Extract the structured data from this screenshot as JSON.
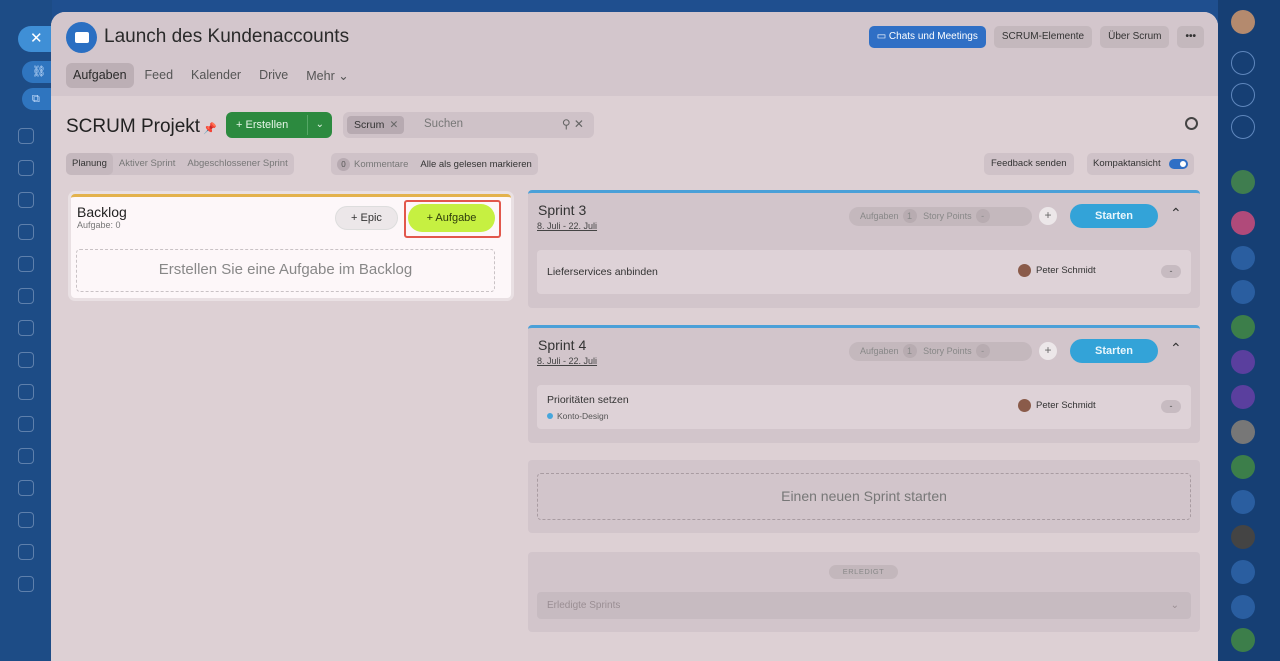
{
  "window": {
    "title": "Launch des Kundenaccounts",
    "tabs": [
      "Aufgaben",
      "Feed",
      "Kalender",
      "Drive",
      "Mehr"
    ],
    "header_buttons": {
      "chats": "Chats und Meetings",
      "scrum_elements": "SCRUM-Elemente",
      "about_scrum": "Über Scrum",
      "more": "•••"
    }
  },
  "toolbar": {
    "section_title": "SCRUM Projekt",
    "create_label": "+ Erstellen",
    "search_chip": "Scrum",
    "search_placeholder": "Suchen"
  },
  "subtabs": [
    "Planung",
    "Aktiver Sprint",
    "Abgeschlossener Sprint"
  ],
  "comments": {
    "count": "0",
    "label": "Kommentare",
    "mark_read": "Alle als gelesen markieren"
  },
  "feedback_label": "Feedback senden",
  "compact_label": "Kompaktansicht",
  "backlog": {
    "title": "Backlog",
    "count": "Aufgabe: 0",
    "epic_label": "+  Epic",
    "task_label": "+  Aufgabe",
    "empty_text": "Erstellen Sie eine Aufgabe im Backlog"
  },
  "sprints": [
    {
      "name": "Sprint 3",
      "dates": "8. Juli - 22. Juli",
      "tasks_label": "Aufgaben",
      "tasks_count": "1",
      "points_label": "Story Points",
      "points_value": "-",
      "add": "+",
      "start": "Starten",
      "task": {
        "title": "Lieferservices anbinden",
        "epic": "",
        "assignee": "Peter Schmidt",
        "points": "-"
      }
    },
    {
      "name": "Sprint 4",
      "dates": "8. Juli - 22. Juli",
      "tasks_label": "Aufgaben",
      "tasks_count": "1",
      "points_label": "Story Points",
      "points_value": "-",
      "add": "+",
      "start": "Starten",
      "task": {
        "title": "Prioritäten setzen",
        "epic": "Konto-Design",
        "assignee": "Peter Schmidt",
        "points": "-"
      }
    }
  ],
  "new_sprint_label": "Einen neuen Sprint starten",
  "done": {
    "badge": "ERLEDIGT",
    "select_label": "Erledigte Sprints"
  },
  "colors": {
    "accent_green": "#c6f041",
    "start_blue": "#33a3d8",
    "create_green": "#2c8a3f",
    "highlight_red": "#e2574c"
  }
}
